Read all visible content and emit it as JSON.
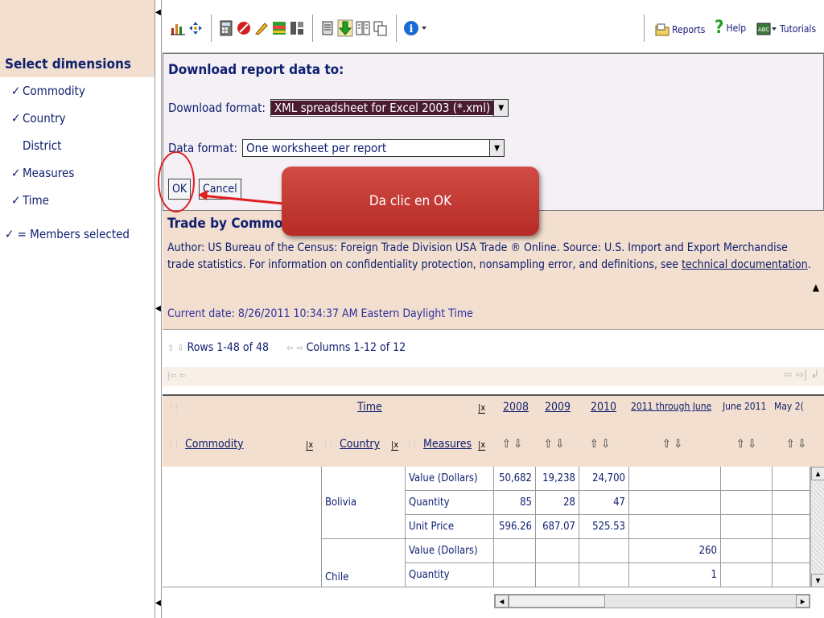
{
  "left": {
    "heading": "Select dimensions",
    "items": [
      {
        "label": "Commodity",
        "check": "✓"
      },
      {
        "label": "Country",
        "check": "✓"
      },
      {
        "label": "District",
        "check": ""
      },
      {
        "label": "Measures",
        "check": "✓"
      },
      {
        "label": "Time",
        "check": "✓"
      }
    ],
    "legend": "✓ = Members selected"
  },
  "toolbar": {
    "reports": "Reports",
    "help": "Help",
    "tutorials": "Tutorials"
  },
  "download": {
    "title": "Download report data to:",
    "download_format_label": "Download format:",
    "download_format_value": "XML spreadsheet for Excel 2003 (*.xml)",
    "data_format_label": "Data format:",
    "data_format_value": "One worksheet per report",
    "ok_label": "OK",
    "cancel_label": "Cancel"
  },
  "report": {
    "title": "Trade by Commod",
    "description": "Author: US Bureau of the Census: Foreign Trade Division USA Trade ® Online. Source: U.S. Import and Export Merchandise trade statistics. For information on confidentiality protection, nonsampling error, and definitions, see",
    "link_text": "technical documentation",
    "date": "Current date: 8/26/2011 10:34:37 AM Eastern Daylight Time"
  },
  "paging": {
    "rows": "Rows 1-48 of 48",
    "columns": "Columns 1-12 of 12"
  },
  "grid": {
    "time_header": "Time",
    "col_headers": [
      "2008",
      "2009",
      "2010",
      "2011 through June",
      "June 2011",
      "May 2("
    ],
    "commodity_header": "Commodity",
    "country_header": "Country",
    "measures_header": "Measures",
    "rows": [
      {
        "country": "Bolivia",
        "measure": "Value (Dollars)",
        "values": [
          "50,682",
          "19,238",
          "24,700",
          "",
          "",
          ""
        ]
      },
      {
        "country": "",
        "measure": "Quantity",
        "values": [
          "85",
          "28",
          "47",
          "",
          "",
          ""
        ]
      },
      {
        "country": "",
        "measure": "Unit Price",
        "values": [
          "596.26",
          "687.07",
          "525.53",
          "",
          "",
          ""
        ]
      },
      {
        "country": "Chile",
        "measure": "Value (Dollars)",
        "values": [
          "",
          "",
          "",
          "260",
          "",
          ""
        ]
      },
      {
        "country": "",
        "measure": "Quantity",
        "values": [
          "",
          "",
          "",
          "1",
          "",
          ""
        ]
      }
    ]
  },
  "callout": {
    "text": "Da clic en OK"
  }
}
